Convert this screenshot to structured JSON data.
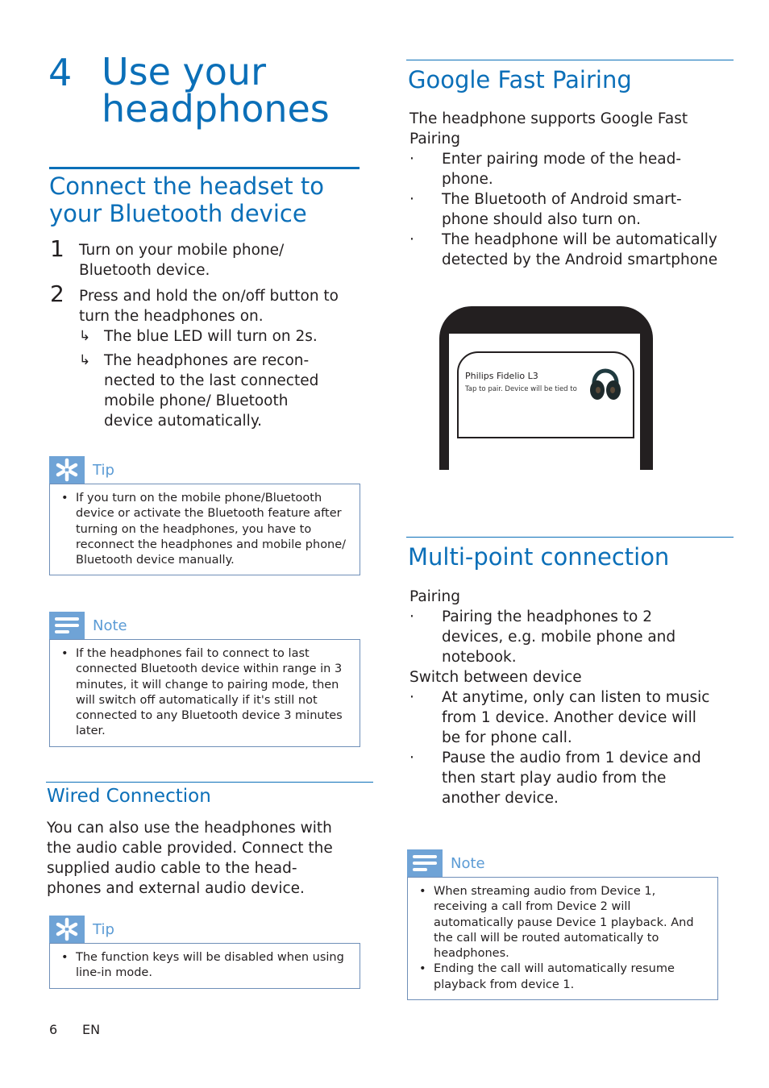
{
  "chapter": {
    "number": "4",
    "title_line1": "Use your",
    "title_line2": "headphones"
  },
  "connect": {
    "heading_line1": "Connect the headset to",
    "heading_line2": "your Bluetooth device",
    "steps": [
      {
        "num": "1",
        "line1": "Turn on your mobile phone/",
        "line2": "Bluetooth device."
      },
      {
        "num": "2",
        "line1": "Press and hold the on/off button to",
        "line2": "turn the headphones on."
      }
    ],
    "results": [
      {
        "lines": [
          "The blue LED will turn on 2s."
        ]
      },
      {
        "lines": [
          "The headphones are recon-",
          "nected to the last connected",
          "mobile phone/ Bluetooth",
          "device automatically."
        ]
      }
    ],
    "result_arrow": "↳"
  },
  "tip1": {
    "label": "Tip",
    "icon": "asterisk-icon",
    "items": [
      "If you turn on the mobile phone/Bluetooth device or activate the Bluetooth feature after turning on the headphones, you have to reconnect the headphones and mobile phone/ Bluetooth device manually."
    ]
  },
  "note1": {
    "label": "Note",
    "icon": "note-lines-icon",
    "items": [
      "If the headphones fail to connect to last connected Bluetooth device within range in 3 minutes, it will change to pairing mode, then will switch off automatically if it's still not connected to any Bluetooth device 3 minutes later."
    ]
  },
  "wired": {
    "heading": "Wired Connection",
    "lines": [
      "You can also use the headphones with",
      "the audio cable provided. Connect the",
      "supplied audio cable to the head-",
      "phones and external audio device."
    ]
  },
  "tip2": {
    "label": "Tip",
    "icon": "asterisk-icon",
    "items": [
      "The function keys will be disabled when using line-in mode."
    ]
  },
  "google": {
    "heading": "Google Fast Pairing",
    "intro_line1": "The headphone supports Google Fast",
    "intro_line2": "Pairing",
    "bullets": [
      {
        "lines": [
          "Enter pairing mode of the head-",
          "phone."
        ]
      },
      {
        "lines": [
          "The Bluetooth of Android smart-",
          "phone should also turn on."
        ]
      },
      {
        "lines": [
          "The headphone will be automatically",
          "detected by the Android smartphone"
        ]
      }
    ]
  },
  "phone_popup": {
    "title": "Philips Fidelio L3",
    "subtitle": "Tap to pair. Device will be tied to"
  },
  "multipoint": {
    "heading": "Multi-point connection",
    "pairing_label": "Pairing",
    "pairing_bullets": [
      {
        "lines": [
          "Pairing the headphones to 2",
          "devices, e.g. mobile phone and",
          "notebook."
        ]
      }
    ],
    "switch_label": "Switch between device",
    "switch_bullets": [
      {
        "lines": [
          "At anytime, only can listen to music",
          "from 1 device. Another device will",
          "be for phone call."
        ]
      },
      {
        "lines": [
          "Pause the audio from 1 device and",
          "then start play audio from the",
          "another device."
        ]
      }
    ]
  },
  "note2": {
    "label": "Note",
    "icon": "note-lines-icon",
    "items": [
      "When streaming audio from Device 1, receiving a call from Device 2 will automatically pause Device 1 playback. And the call will be routed automatically to headphones.",
      "Ending the call will automatically resume playback from device 1."
    ]
  },
  "footer": {
    "page_number": "6",
    "language": "EN"
  },
  "colors": {
    "accent": "#0b6fb8",
    "box_icon": "#6fa3d6",
    "text": "#231f20"
  }
}
